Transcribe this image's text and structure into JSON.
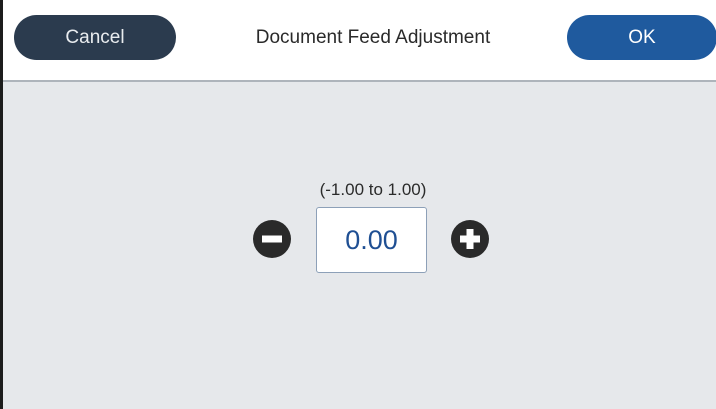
{
  "dialog": {
    "title": "Document Feed Adjustment",
    "cancel_label": "Cancel",
    "ok_label": "OK"
  },
  "adjustment": {
    "range_label": "(-1.00 to 1.00)",
    "value": "0.00",
    "decrease_icon": "minus-circle-icon",
    "increase_icon": "plus-circle-icon"
  },
  "colors": {
    "cancel_button": "#2b3b4e",
    "ok_button": "#1f5a9e",
    "value_text": "#1f4f93",
    "content_background": "#e6e8eb"
  }
}
